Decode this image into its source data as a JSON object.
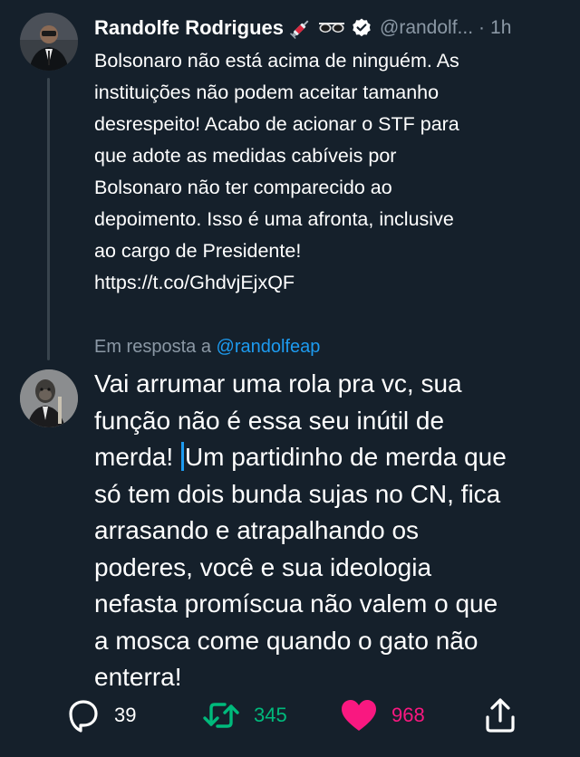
{
  "tweet": {
    "author_name": "Randolfe Rodrigues",
    "author_emojis": [
      "syringe-emoji",
      "sunglasses-emoji"
    ],
    "verified": true,
    "handle": "@randolf...",
    "separator": "·",
    "time": "1h",
    "lines": [
      "Bolsonaro não está acima de ninguém. As",
      "instituições não podem aceitar tamanho",
      "desrespeito! Acabo de acionar o STF para",
      "que adote as medidas cabíveis por",
      "Bolsonaro não ter comparecido ao",
      "depoimento. Isso é uma afronta, inclusive",
      "ao cargo de Presidente!"
    ],
    "link": "https://t.co/GhdvjEjxQF"
  },
  "reply": {
    "reply_to_prefix": "Em resposta a",
    "reply_to_handle": "@randolfeap",
    "lines_before_caret": [
      "Vai arrumar uma rola pra vc, sua",
      "função não é essa seu inútil de"
    ],
    "line3_before_caret": "merda!",
    "line3_after_caret": "Um partidinho de merda que",
    "lines_after": [
      "só tem dois bunda sujas no CN, fica",
      "arrasando e atrapalhando os",
      "poderes, você e sua ideologia",
      "nefasta promíscua não valem o que",
      "a mosca come quando o gato não",
      "enterra!"
    ]
  },
  "actions": {
    "reply_count": "39",
    "retweet_count": "345",
    "like_count": "968",
    "colors": {
      "reply": "#ffffff",
      "retweet": "#00ba7c",
      "like": "#f91880",
      "share": "#ffffff"
    }
  }
}
